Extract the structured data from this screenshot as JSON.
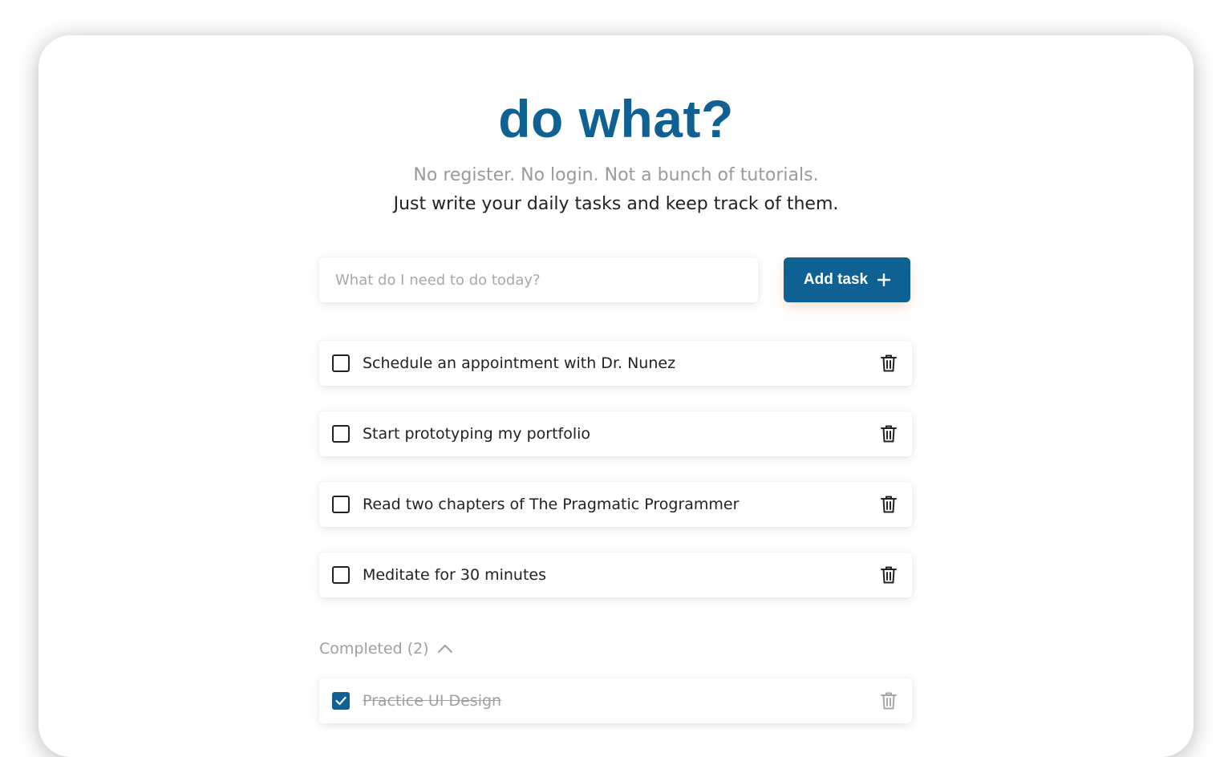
{
  "app": {
    "title": "do what?",
    "tagline_muted": "No register. No login. Not a bunch of tutorials.",
    "tagline": "Just write your daily tasks and keep track of them."
  },
  "composer": {
    "placeholder": "What do I need to do today?",
    "value": "",
    "add_label": "Add task",
    "add_icon": "plus-icon"
  },
  "tasks": [
    {
      "label": "Schedule an appointment with Dr. Nunez",
      "done": false
    },
    {
      "label": "Start prototyping my portfolio",
      "done": false
    },
    {
      "label": "Read two chapters of The Pragmatic Programmer",
      "done": false
    },
    {
      "label": "Meditate for 30 minutes",
      "done": false
    }
  ],
  "completed": {
    "label": "Completed (2)",
    "expanded": true,
    "toggle_icon": "chevron-up-icon",
    "items": [
      {
        "label": "Practice UI Design",
        "done": true
      }
    ]
  },
  "colors": {
    "brand": "#0f6193",
    "muted_text": "#9a9a9a",
    "text": "#222222"
  }
}
